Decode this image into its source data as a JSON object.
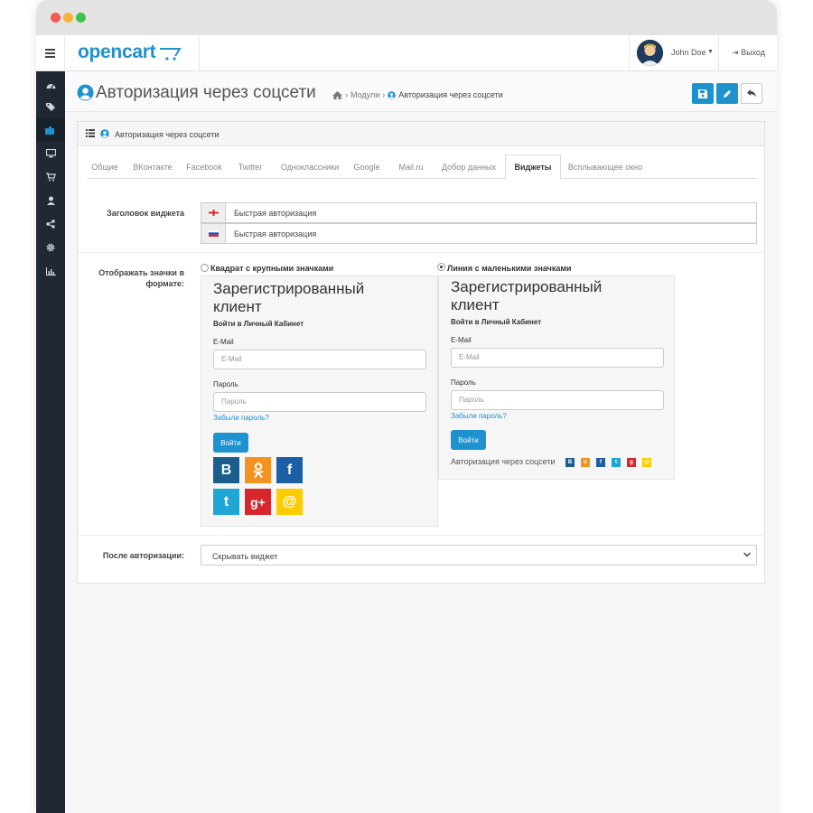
{
  "header": {
    "logo": "opencart",
    "user_name": "John Doe",
    "logout": "Выход"
  },
  "sidebar": {
    "icons": [
      "dashboard-icon",
      "tags-icon",
      "puzzle-icon",
      "desktop-icon",
      "cart-icon",
      "user-icon",
      "share-icon",
      "gear-icon",
      "bar-chart-icon"
    ]
  },
  "page": {
    "title": "Авторизация через соцсети",
    "breadcrumb": {
      "modules": "Модули",
      "current": "Авторизация через соцсети"
    }
  },
  "panel": {
    "heading": "Авторизация через соцсети",
    "tabs": [
      "Общие",
      "ВКонтакте",
      "Facebook",
      "Twitter",
      "Одноклассники",
      "Google",
      "Mail.ru",
      "Добор данных",
      "Виджеты",
      "Всплывающее окно"
    ],
    "active_tab": "Виджеты"
  },
  "form": {
    "widget_title_label": "Заголовок виджета",
    "widget_title_en": "Быстрая авторизация",
    "widget_title_ru": "Быстрая авторизация",
    "display_label": "Отображать значки в формате:",
    "option_square": "Квадрат с крупными значками",
    "option_line": "Линия с маленькими значками",
    "after_auth_label": "После авторизации:",
    "after_auth_value": "Скрывать виджет"
  },
  "preview": {
    "title": "Зарегистрированный клиент",
    "subtitle": "Войти в Личный Кабинет",
    "email_label": "E-Mail",
    "email_placeholder": "E-Mail",
    "password_label": "Пароль",
    "password_placeholder": "Пароль",
    "forgot": "Забыли пароль?",
    "login_button": "Войти",
    "social_inline": "Авторизация через соцсети"
  },
  "colors": {
    "accent": "#1e91cf",
    "vk": "#1b5e8e",
    "ok": "#f39221",
    "facebook": "#1d5fa6",
    "twitter": "#1fa5d6",
    "google": "#d8262d",
    "mailru": "#ffcc00"
  }
}
